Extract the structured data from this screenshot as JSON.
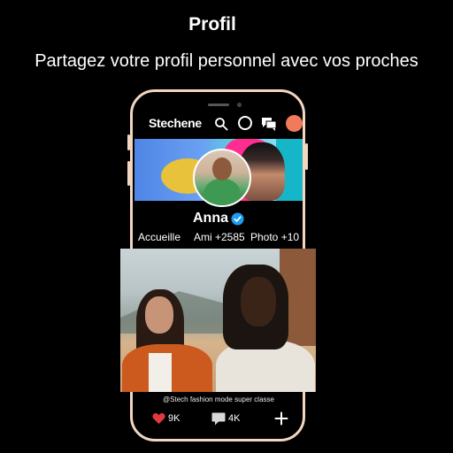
{
  "page": {
    "title": "Profil",
    "subtitle": "Partagez votre profil personnel avec vos proches"
  },
  "app": {
    "logo": "Stechene",
    "icons": [
      "search-icon",
      "circle-icon",
      "chat-icon",
      "avatar-icon"
    ]
  },
  "profile": {
    "name": "Anna",
    "verified": true,
    "tabs": [
      {
        "label": "Accueille"
      },
      {
        "label": "Ami +2585"
      },
      {
        "label": "Photo +10"
      }
    ]
  },
  "post": {
    "caption": "@Stech  fashion  mode super classe",
    "likes": "9K",
    "comments": "4K"
  },
  "colors": {
    "background": "#000000",
    "phone_frame": "#f2d6c0",
    "heart": "#e0393e",
    "verified": "#1d9bf0"
  }
}
